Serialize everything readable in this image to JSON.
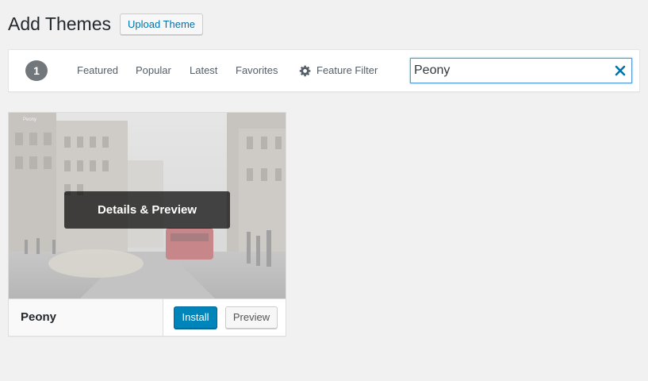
{
  "header": {
    "title": "Add Themes",
    "upload_label": "Upload Theme"
  },
  "filter_bar": {
    "count": "1",
    "tabs": [
      {
        "label": "Featured"
      },
      {
        "label": "Popular"
      },
      {
        "label": "Latest"
      },
      {
        "label": "Favorites"
      }
    ],
    "feature_filter": {
      "label": "Feature Filter",
      "icon": "gear-icon"
    },
    "search": {
      "value": "Peony",
      "clear_icon": "close-icon"
    }
  },
  "theme": {
    "name": "Peony",
    "overlay_label": "Details & Preview",
    "install_label": "Install",
    "preview_label": "Preview"
  },
  "colors": {
    "primary": "#0085ba",
    "link": "#0073aa",
    "background": "#f1f1f1"
  }
}
